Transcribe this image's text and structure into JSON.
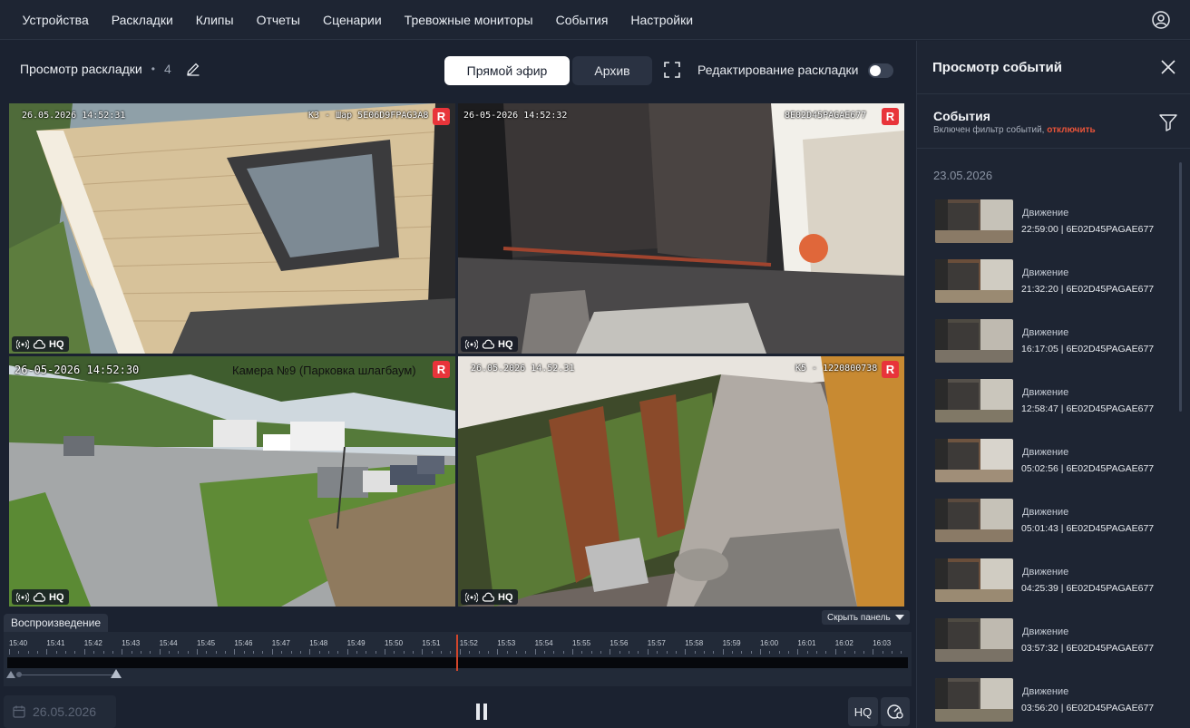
{
  "nav": {
    "items": [
      "Устройства",
      "Раскладки",
      "Клипы",
      "Отчеты",
      "Сценарии",
      "Тревожные мониторы",
      "События",
      "Настройки"
    ]
  },
  "layout": {
    "title": "Просмотр раскладки",
    "dot": "•",
    "count": "4",
    "live_label": "Прямой эфир",
    "archive_label": "Архив",
    "edit_label": "Редактирование раскладки",
    "edit_enabled": false
  },
  "cameras": [
    {
      "timestamp": "26.05.2026 14:52:31",
      "name": "К3 - Шар 5E06D9FPAG3A8",
      "rec": "R",
      "quality": "HQ"
    },
    {
      "timestamp": "26-05-2026 14:52:32",
      "name": "8E02D45PAGAE677",
      "rec": "R",
      "quality": "HQ"
    },
    {
      "timestamp": "26-05-2026 14:52:30",
      "name": "Камера №9 (Парковка шлагбаум)",
      "rec": "R",
      "quality": "HQ"
    },
    {
      "timestamp": "26.05.2026 14.52.31",
      "name": "К5 - 1220800738",
      "rec": "R",
      "quality": "HQ"
    }
  ],
  "playback": {
    "tab_label": "Воспроизведение",
    "hide_panel_label": "Скрыть панель",
    "ticks": [
      "15:40",
      "15:41",
      "15:42",
      "15:43",
      "15:44",
      "15:45",
      "15:46",
      "15:47",
      "15:48",
      "15:49",
      "15:50",
      "15:51",
      "15:52",
      "15:53",
      "15:54",
      "15:55",
      "15:56",
      "15:57",
      "15:58",
      "15:59",
      "16:00",
      "16:01",
      "16:02",
      "16:03"
    ],
    "date": "26.05.2026",
    "hq_label": "HQ"
  },
  "events_panel": {
    "title": "Просмотр событий",
    "subtitle": "События",
    "filter_note": "Включен фильтр событий, ",
    "filter_link": "отключить",
    "date": "23.05.2026",
    "events": [
      {
        "type": "Движение",
        "time": "22:59:00",
        "device": "6E02D45PAGAE677"
      },
      {
        "type": "Движение",
        "time": "21:32:20",
        "device": "6E02D45PAGAE677"
      },
      {
        "type": "Движение",
        "time": "16:17:05",
        "device": "6E02D45PAGAE677"
      },
      {
        "type": "Движение",
        "time": "12:58:47",
        "device": "6E02D45PAGAE677"
      },
      {
        "type": "Движение",
        "time": "05:02:56",
        "device": "6E02D45PAGAE677"
      },
      {
        "type": "Движение",
        "time": "05:01:43",
        "device": "6E02D45PAGAE677"
      },
      {
        "type": "Движение",
        "time": "04:25:39",
        "device": "6E02D45PAGAE677"
      },
      {
        "type": "Движение",
        "time": "03:57:32",
        "device": "6E02D45PAGAE677"
      },
      {
        "type": "Движение",
        "time": "03:56:20",
        "device": "6E02D45PAGAE677"
      }
    ]
  },
  "colors": {
    "accent_red": "#e8343a",
    "link_orange": "#e8543a",
    "background": "#1b2230"
  }
}
